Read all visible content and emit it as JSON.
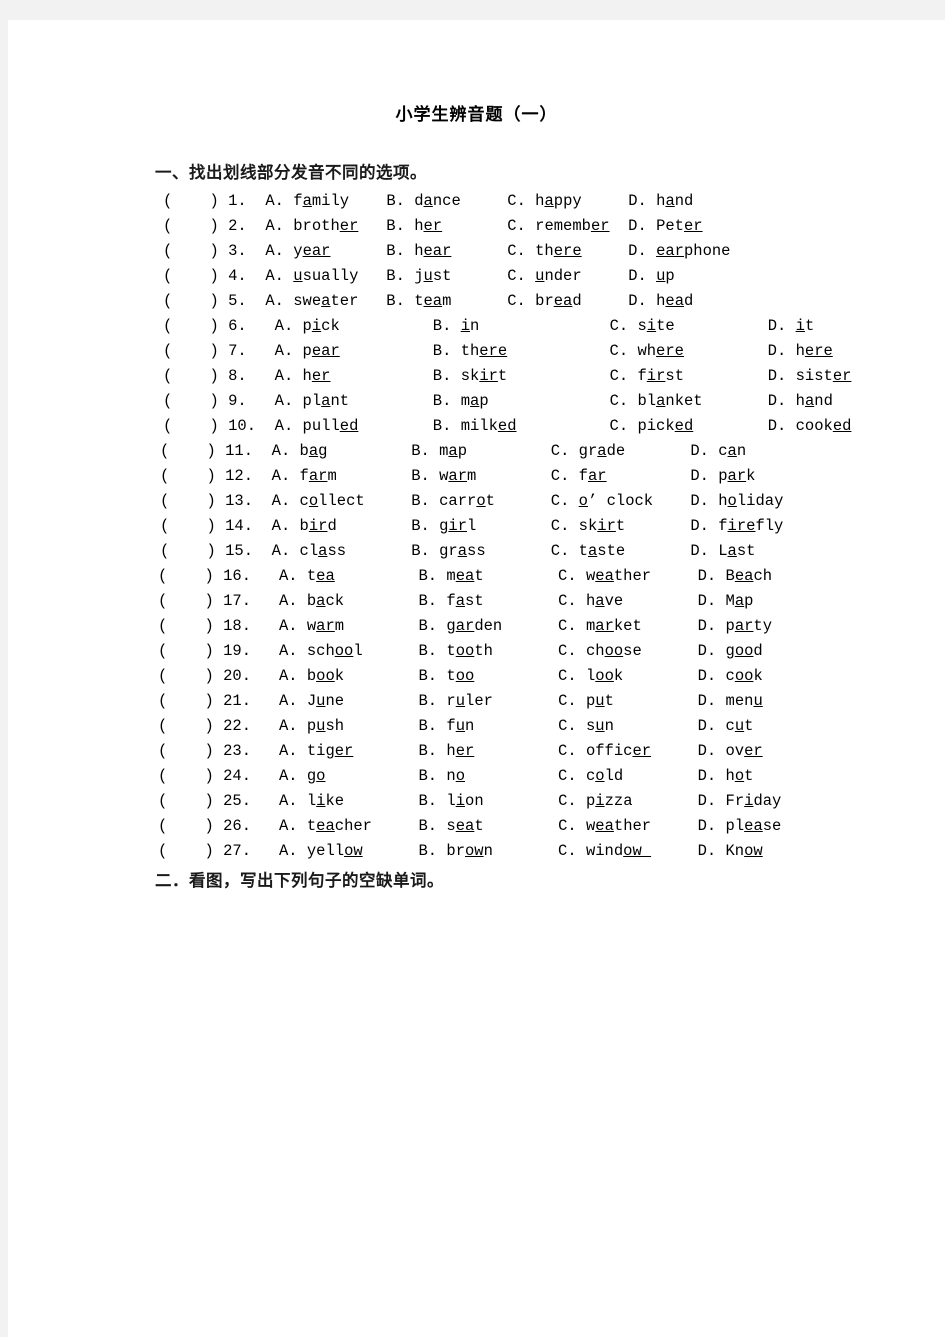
{
  "document": {
    "title": "小学生辨音题（一）",
    "sections": [
      {
        "id": "one",
        "heading": "一、找出划线部分发音不同的选项。"
      },
      {
        "id": "two",
        "heading": "二．看图，写出下列句子的空缺单词。"
      }
    ]
  },
  "questions": [
    {
      "number": "1.",
      "marker": "(    )",
      "options": [
        {
          "label": "A.",
          "pre": "f",
          "u": "a",
          "post": "mily"
        },
        {
          "label": "B.",
          "pre": "d",
          "u": "a",
          "post": "nce"
        },
        {
          "label": "C.",
          "pre": "h",
          "u": "a",
          "post": "ppy"
        },
        {
          "label": "D.",
          "pre": "h",
          "u": "a",
          "post": "nd"
        }
      ]
    },
    {
      "number": "2.",
      "marker": "(    )",
      "options": [
        {
          "label": "A.",
          "pre": "broth",
          "u": "er",
          "post": ""
        },
        {
          "label": "B.",
          "pre": "h",
          "u": "er",
          "post": ""
        },
        {
          "label": "C.",
          "pre": "rememb",
          "u": "er",
          "post": ""
        },
        {
          "label": "D.",
          "pre": "Pet",
          "u": "er",
          "post": ""
        }
      ]
    },
    {
      "number": "3.",
      "marker": "(    )",
      "options": [
        {
          "label": "A.",
          "pre": "y",
          "u": "ear",
          "post": ""
        },
        {
          "label": "B.",
          "pre": "h",
          "u": "ear",
          "post": ""
        },
        {
          "label": "C.",
          "pre": "th",
          "u": "ere",
          "post": ""
        },
        {
          "label": "D.",
          "pre": "",
          "u": "ear",
          "post": "phone"
        }
      ]
    },
    {
      "number": "4.",
      "marker": "(    )",
      "options": [
        {
          "label": "A.",
          "pre": "",
          "u": "u",
          "post": "sually"
        },
        {
          "label": "B.",
          "pre": "j",
          "u": "u",
          "post": "st"
        },
        {
          "label": "C.",
          "pre": "",
          "u": "u",
          "post": "nder"
        },
        {
          "label": "D.",
          "pre": "",
          "u": "u",
          "post": "p"
        }
      ]
    },
    {
      "number": "5.",
      "marker": "(    )",
      "options": [
        {
          "label": "A.",
          "pre": "swe",
          "u": "a",
          "post": "ter"
        },
        {
          "label": "B.",
          "pre": "t",
          "u": "ea",
          "post": "m"
        },
        {
          "label": "C.",
          "pre": "br",
          "u": "ea",
          "post": "d"
        },
        {
          "label": "D.",
          "pre": "h",
          "u": "ea",
          "post": "d"
        }
      ]
    },
    {
      "number": "6.",
      "marker": "(    )",
      "options": [
        {
          "label": "A.",
          "pre": "p",
          "u": "i",
          "post": "ck"
        },
        {
          "label": "B.",
          "pre": "",
          "u": "i",
          "post": "n"
        },
        {
          "label": "C.",
          "pre": "s",
          "u": "i",
          "post": "te"
        },
        {
          "label": "D.",
          "pre": "",
          "u": "i",
          "post": "t"
        }
      ]
    },
    {
      "number": "7.",
      "marker": "(    )",
      "options": [
        {
          "label": "A.",
          "pre": "p",
          "u": "ear",
          "post": ""
        },
        {
          "label": "B.",
          "pre": "th",
          "u": "ere",
          "post": ""
        },
        {
          "label": "C.",
          "pre": "wh",
          "u": "ere",
          "post": ""
        },
        {
          "label": "D.",
          "pre": "h",
          "u": "ere",
          "post": ""
        }
      ]
    },
    {
      "number": "8.",
      "marker": "(    )",
      "options": [
        {
          "label": "A.",
          "pre": "h",
          "u": "er",
          "post": ""
        },
        {
          "label": "B.",
          "pre": "sk",
          "u": "ir",
          "post": "t"
        },
        {
          "label": "C.",
          "pre": "f",
          "u": "ir",
          "post": "st"
        },
        {
          "label": "D.",
          "pre": "sist",
          "u": "er",
          "post": ""
        }
      ]
    },
    {
      "number": "9.",
      "marker": "(    )",
      "options": [
        {
          "label": "A.",
          "pre": "pl",
          "u": "a",
          "post": "nt"
        },
        {
          "label": "B.",
          "pre": "m",
          "u": "a",
          "post": "p"
        },
        {
          "label": "C.",
          "pre": "bl",
          "u": "a",
          "post": "nket"
        },
        {
          "label": "D.",
          "pre": "h",
          "u": "a",
          "post": "nd"
        }
      ]
    },
    {
      "number": "10.",
      "marker": "(    )",
      "options": [
        {
          "label": "A.",
          "pre": "pull",
          "u": "ed",
          "post": ""
        },
        {
          "label": "B.",
          "pre": "milk",
          "u": "ed",
          "post": ""
        },
        {
          "label": "C.",
          "pre": "pick",
          "u": "ed",
          "post": ""
        },
        {
          "label": "D.",
          "pre": "cook",
          "u": "ed",
          "post": ""
        }
      ]
    },
    {
      "number": "11.",
      "marker": "(    )",
      "options": [
        {
          "label": "A.",
          "pre": "b",
          "u": "a",
          "post": "g"
        },
        {
          "label": "B.",
          "pre": "m",
          "u": "a",
          "post": "p"
        },
        {
          "label": "C.",
          "pre": "gr",
          "u": "a",
          "post": "de"
        },
        {
          "label": "D.",
          "pre": "c",
          "u": "a",
          "post": "n"
        }
      ]
    },
    {
      "number": "12.",
      "marker": "(    )",
      "options": [
        {
          "label": "A.",
          "pre": "f",
          "u": "ar",
          "post": "m"
        },
        {
          "label": "B.",
          "pre": "w",
          "u": "ar",
          "post": "m"
        },
        {
          "label": "C.",
          "pre": "f",
          "u": "ar",
          "post": ""
        },
        {
          "label": "D.",
          "pre": "p",
          "u": "ar",
          "post": "k"
        }
      ]
    },
    {
      "number": "13.",
      "marker": "(    )",
      "options": [
        {
          "label": "A.",
          "pre": "c",
          "u": "o",
          "post": "llect"
        },
        {
          "label": "B.",
          "pre": "carr",
          "u": "o",
          "post": "t"
        },
        {
          "label": "C.",
          "pre": "",
          "u": "o",
          "post": "’ clock"
        },
        {
          "label": "D.",
          "pre": "h",
          "u": "o",
          "post": "liday"
        }
      ]
    },
    {
      "number": "14.",
      "marker": "(    )",
      "options": [
        {
          "label": "A.",
          "pre": "b",
          "u": "ir",
          "post": "d"
        },
        {
          "label": "B.",
          "pre": "g",
          "u": "ir",
          "post": "l"
        },
        {
          "label": "C.",
          "pre": "sk",
          "u": "ir",
          "post": "t"
        },
        {
          "label": "D.",
          "pre": "f",
          "u": "ire",
          "post": "fly"
        }
      ]
    },
    {
      "number": "15.",
      "marker": "(    )",
      "options": [
        {
          "label": "A.",
          "pre": "cl",
          "u": "a",
          "post": "ss"
        },
        {
          "label": "B.",
          "pre": "gr",
          "u": "a",
          "post": "ss"
        },
        {
          "label": "C.",
          "pre": "t",
          "u": "a",
          "post": "ste"
        },
        {
          "label": "D.",
          "pre": "L",
          "u": "a",
          "post": "st"
        }
      ]
    },
    {
      "number": "16.",
      "marker": "(    )",
      "options": [
        {
          "label": "A.",
          "pre": "t",
          "u": "ea",
          "post": ""
        },
        {
          "label": "B.",
          "pre": "m",
          "u": "ea",
          "post": "t"
        },
        {
          "label": "C.",
          "pre": "w",
          "u": "ea",
          "post": "ther"
        },
        {
          "label": "D.",
          "pre": "B",
          "u": "ea",
          "post": "ch"
        }
      ]
    },
    {
      "number": "17.",
      "marker": "(    )",
      "options": [
        {
          "label": "A.",
          "pre": "b",
          "u": "a",
          "post": "ck"
        },
        {
          "label": "B.",
          "pre": "f",
          "u": "a",
          "post": "st"
        },
        {
          "label": "C.",
          "pre": "h",
          "u": "a",
          "post": "ve"
        },
        {
          "label": "D.",
          "pre": "M",
          "u": "a",
          "post": "p"
        }
      ]
    },
    {
      "number": "18.",
      "marker": "(    )",
      "options": [
        {
          "label": "A.",
          "pre": "w",
          "u": "ar",
          "post": "m"
        },
        {
          "label": "B.",
          "pre": "g",
          "u": "ar",
          "post": "den"
        },
        {
          "label": "C.",
          "pre": "m",
          "u": "ar",
          "post": "ket"
        },
        {
          "label": "D.",
          "pre": "p",
          "u": "ar",
          "post": "ty"
        }
      ]
    },
    {
      "number": "19.",
      "marker": "(    )",
      "options": [
        {
          "label": "A.",
          "pre": "sch",
          "u": "oo",
          "post": "l"
        },
        {
          "label": "B.",
          "pre": "t",
          "u": "oo",
          "post": "th"
        },
        {
          "label": "C.",
          "pre": "ch",
          "u": "oo",
          "post": "se"
        },
        {
          "label": "D.",
          "pre": "g",
          "u": "oo",
          "post": "d"
        }
      ]
    },
    {
      "number": "20.",
      "marker": "(    )",
      "options": [
        {
          "label": "A.",
          "pre": "b",
          "u": "oo",
          "post": "k"
        },
        {
          "label": "B.",
          "pre": "t",
          "u": "oo",
          "post": ""
        },
        {
          "label": "C.",
          "pre": "l",
          "u": "oo",
          "post": "k"
        },
        {
          "label": "D.",
          "pre": "c",
          "u": "oo",
          "post": "k"
        }
      ]
    },
    {
      "number": "21.",
      "marker": "(    )",
      "options": [
        {
          "label": "A.",
          "pre": "J",
          "u": "u",
          "post": "ne"
        },
        {
          "label": "B.",
          "pre": "r",
          "u": "u",
          "post": "ler"
        },
        {
          "label": "C.",
          "pre": "p",
          "u": "u",
          "post": "t"
        },
        {
          "label": "D.",
          "pre": "men",
          "u": "u",
          "post": ""
        }
      ]
    },
    {
      "number": "22.",
      "marker": "(    )",
      "options": [
        {
          "label": "A.",
          "pre": "p",
          "u": "u",
          "post": "sh"
        },
        {
          "label": "B.",
          "pre": "f",
          "u": "u",
          "post": "n"
        },
        {
          "label": "C.",
          "pre": "s",
          "u": "u",
          "post": "n"
        },
        {
          "label": "D.",
          "pre": "c",
          "u": "u",
          "post": "t"
        }
      ]
    },
    {
      "number": "23.",
      "marker": "(    )",
      "options": [
        {
          "label": "A.",
          "pre": "tig",
          "u": "er",
          "post": ""
        },
        {
          "label": "B.",
          "pre": "h",
          "u": "er",
          "post": ""
        },
        {
          "label": "C.",
          "pre": "offic",
          "u": "er",
          "post": ""
        },
        {
          "label": "D.",
          "pre": "ov",
          "u": "er",
          "post": ""
        }
      ]
    },
    {
      "number": "24.",
      "marker": "(    )",
      "options": [
        {
          "label": "A.",
          "pre": "g",
          "u": "o",
          "post": ""
        },
        {
          "label": "B.",
          "pre": "n",
          "u": "o",
          "post": ""
        },
        {
          "label": "C.",
          "pre": "c",
          "u": "o",
          "post": "ld"
        },
        {
          "label": "D.",
          "pre": "h",
          "u": "o",
          "post": "t"
        }
      ]
    },
    {
      "number": "25.",
      "marker": "(    )",
      "options": [
        {
          "label": "A.",
          "pre": "l",
          "u": "i",
          "post": "ke"
        },
        {
          "label": "B.",
          "pre": "l",
          "u": "i",
          "post": "on"
        },
        {
          "label": "C.",
          "pre": "p",
          "u": "i",
          "post": "zza"
        },
        {
          "label": "D.",
          "pre": "Fr",
          "u": "i",
          "post": "day"
        }
      ]
    },
    {
      "number": "26.",
      "marker": "(    )",
      "options": [
        {
          "label": "A.",
          "pre": "t",
          "u": "ea",
          "post": "cher"
        },
        {
          "label": "B.",
          "pre": "s",
          "u": "ea",
          "post": "t"
        },
        {
          "label": "C.",
          "pre": "w",
          "u": "ea",
          "post": "ther"
        },
        {
          "label": "D.",
          "pre": "pl",
          "u": "ea",
          "post": "se"
        }
      ]
    },
    {
      "number": "27.",
      "marker": "(    )",
      "options": [
        {
          "label": "A.",
          "pre": "yell",
          "u": "ow",
          "post": ""
        },
        {
          "label": "B.",
          "pre": "br",
          "u": "ow",
          "post": "n"
        },
        {
          "label": "C.",
          "pre": "wind",
          "u": "ow ",
          "post": ""
        },
        {
          "label": "D.",
          "pre": "Kn",
          "u": "ow",
          "post": ""
        }
      ]
    }
  ],
  "layout": {
    "columns": [
      {
        "rows": "1-5",
        "indent": 155,
        "num_w": 3,
        "gaps": [
          12,
          12,
          12
        ]
      },
      {
        "rows": "6-10",
        "indent": 155,
        "num_w": 4,
        "gaps": [
          18,
          20,
          18
        ]
      },
      {
        "rows": "11-15",
        "indent": 152,
        "num_w": 5,
        "gaps": [
          13,
          12,
          12
        ]
      },
      {
        "rows": "16-27",
        "indent": 150,
        "num_w": 5,
        "gaps": [
          11,
          11,
          11
        ]
      }
    ]
  }
}
